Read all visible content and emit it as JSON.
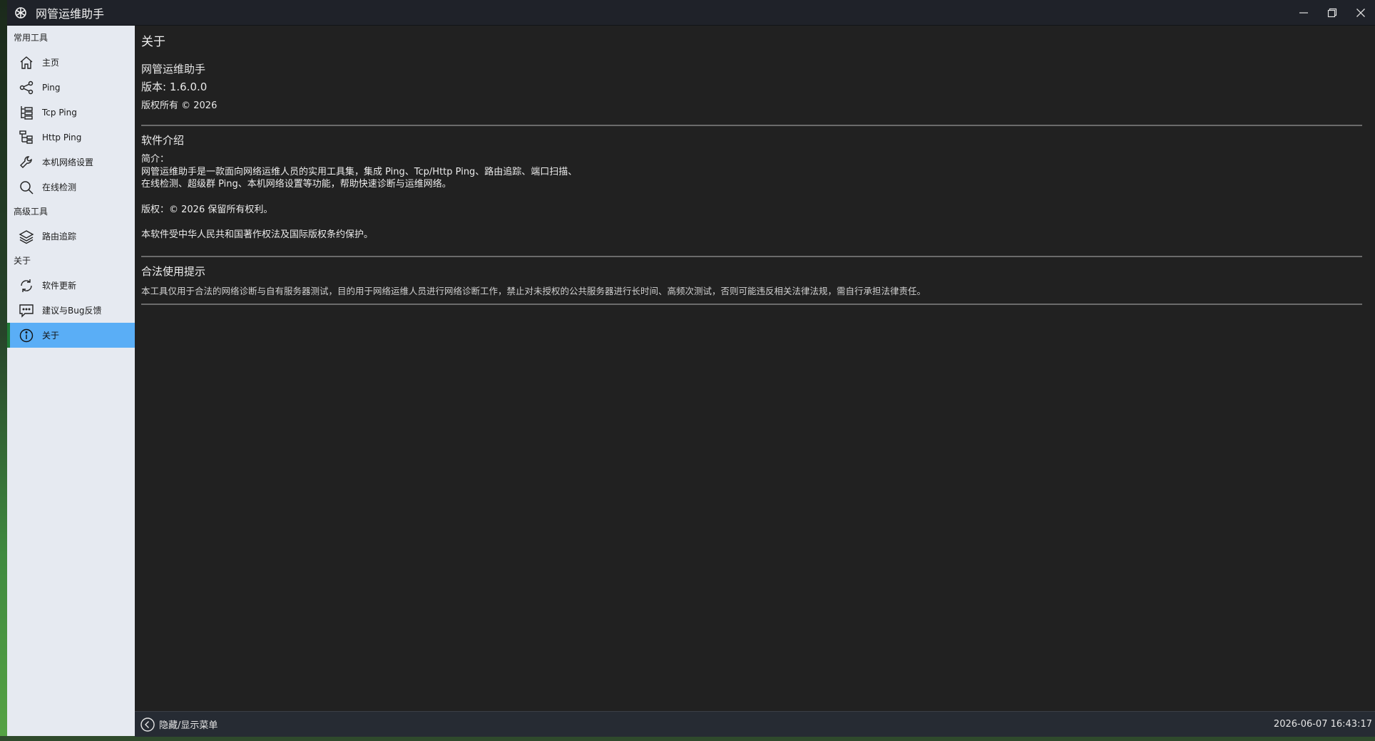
{
  "window": {
    "title": "网管运维助手",
    "icon": "snowflake-icon"
  },
  "sidebar": {
    "sections": [
      {
        "header": "常用工具",
        "items": [
          {
            "label": "主页",
            "icon": "home-icon"
          },
          {
            "label": "Ping",
            "icon": "share-icon"
          },
          {
            "label": "Tcp Ping",
            "icon": "tree-icon"
          },
          {
            "label": "Http Ping",
            "icon": "branch-icon"
          },
          {
            "label": "本机网络设置",
            "icon": "wrench-icon"
          },
          {
            "label": "在线检测",
            "icon": "search-icon"
          }
        ]
      },
      {
        "header": "高级工具",
        "items": [
          {
            "label": "路由追踪",
            "icon": "layers-icon"
          }
        ]
      },
      {
        "header": "关于",
        "items": [
          {
            "label": "软件更新",
            "icon": "refresh-icon"
          },
          {
            "label": "建议与Bug反馈",
            "icon": "feedback-icon"
          },
          {
            "label": "关于",
            "icon": "info-icon",
            "active": true
          }
        ]
      }
    ]
  },
  "main": {
    "page_title": "关于",
    "app_name": "网管运维助手",
    "version": "版本: 1.6.0.0",
    "copyright": "版权所有 © 2026",
    "intro": {
      "title": "软件介绍",
      "lines": [
        "简介：",
        "网管运维助手是一款面向网络运维人员的实用工具集，集成 Ping、Tcp/Http Ping、路由追踪、端口扫描、",
        "在线检测、超级群 Ping、本机网络设置等功能，帮助快速诊断与运维网络。",
        "",
        "版权：© 2026 保留所有权利。",
        "",
        "本软件受中华人民共和国著作权法及国际版权条约保护。"
      ]
    },
    "legal": {
      "title": "合法使用提示",
      "text": "本工具仅用于合法的网络诊断与自有服务器测试，目的用于网络运维人员进行网络诊断工作，禁止对未授权的公共服务器进行长时间、高频次测试，否则可能违反相关法律法规，需自行承担法律责任。"
    }
  },
  "statusbar": {
    "toggle_label": "隐藏/显示菜单",
    "toggle_icon": "chevron-left-circle-icon",
    "datetime": "2026-06-07 16:43:17"
  },
  "colors": {
    "sidebar_bg": "#e6eaf1",
    "active_bg": "#5aaef6",
    "active_indicator": "#1e7a36",
    "content_bg": "#212121",
    "titlebar_bg": "#1f2229"
  }
}
